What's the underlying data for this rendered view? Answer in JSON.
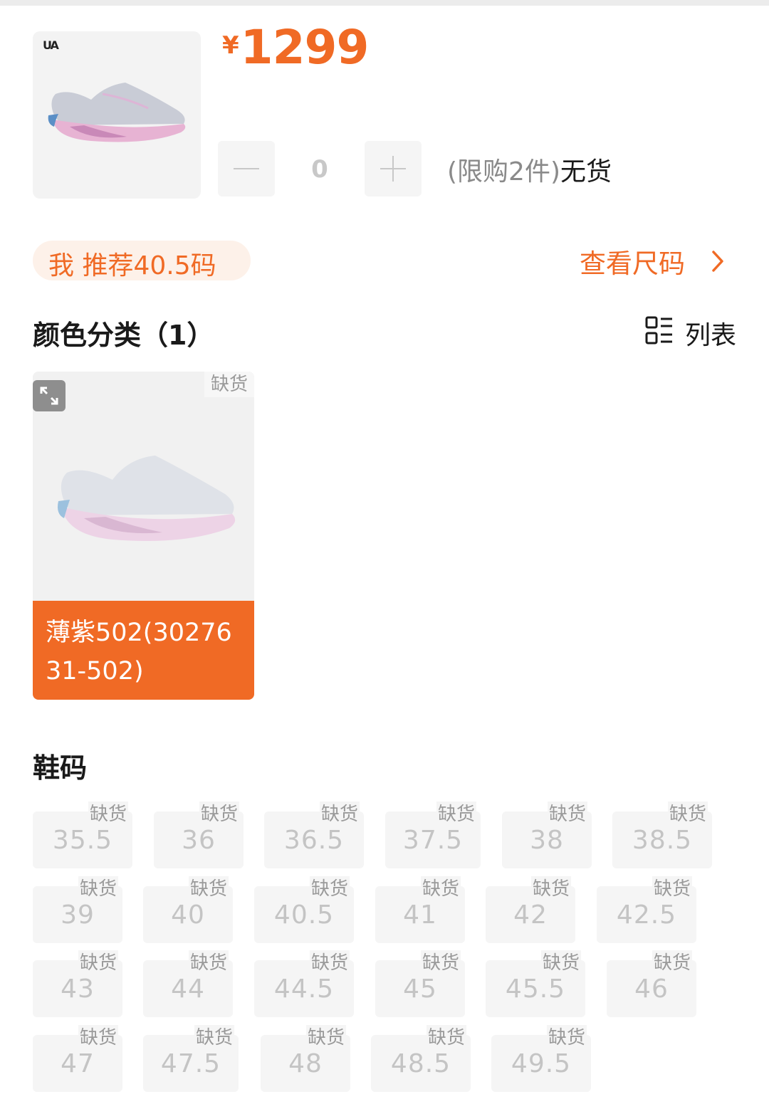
{
  "product": {
    "brand_mark": "UA",
    "price_currency": "¥",
    "price_amount": "1299",
    "quantity": "0",
    "limit_text": "(限购2件)",
    "stock_text": "无货"
  },
  "recommend": {
    "label": "我 推荐40.5码",
    "size_guide_label": "查看尺码"
  },
  "colors": {
    "title": "颜色分类（1）",
    "view_toggle_label": "列表",
    "items": [
      {
        "label": "薄紫502(3027631-502)",
        "stock_tag": "缺货"
      }
    ]
  },
  "sizes": {
    "title": "鞋码",
    "stock_tag": "缺货",
    "items": [
      "35.5",
      "36",
      "36.5",
      "37.5",
      "38",
      "38.5",
      "39",
      "40",
      "40.5",
      "41",
      "42",
      "42.5",
      "43",
      "44",
      "44.5",
      "45",
      "45.5",
      "46",
      "47",
      "47.5",
      "48",
      "48.5",
      "49.5"
    ]
  },
  "icons": {
    "minus": "minus-icon",
    "plus": "plus-icon",
    "chevron": "chevron-right-icon",
    "list": "list-view-icon",
    "expand": "expand-icon"
  },
  "colors_palette": {
    "accent": "#f06a25",
    "accent_light": "#fdf1e9",
    "chip_bg": "#f5f5f5",
    "disabled_text": "#c4c4c4",
    "tag_text": "#9a9a9a"
  }
}
